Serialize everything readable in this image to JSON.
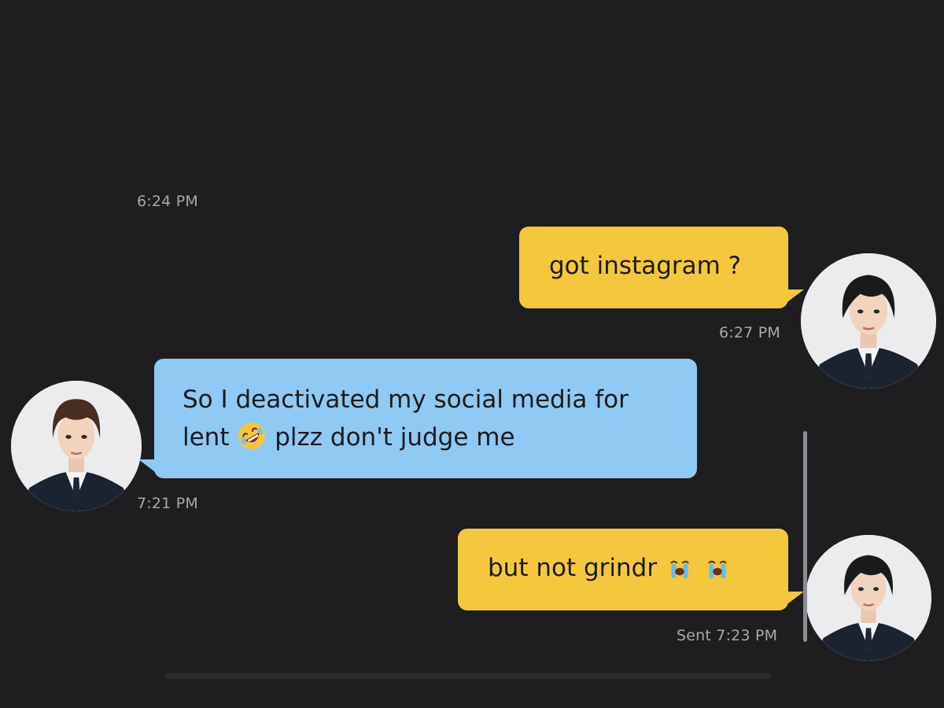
{
  "messages": [
    {
      "id": "m1",
      "direction": "outgoing",
      "text": "got instagram ?",
      "timestamp": "6:24 PM",
      "timestamp_below": "6:27 PM"
    },
    {
      "id": "m2",
      "direction": "incoming",
      "text_line1": "So I deactivated my social media for",
      "text_line2_prefix": "lent",
      "text_line2_suffix": "plzz don't judge me",
      "emoji": "rolling-on-floor-laughing",
      "timestamp": "7:21 PM"
    },
    {
      "id": "m3",
      "direction": "outgoing",
      "text": "but not grindr",
      "emoji": [
        "loudly-crying-face",
        "loudly-crying-face"
      ],
      "timestamp": "Sent 7:23 PM"
    }
  ],
  "colors": {
    "background": "#1e1e20",
    "outgoing_bubble": "#f5c73d",
    "incoming_bubble": "#8ecaf4",
    "timestamp": "#a9a9ad"
  }
}
